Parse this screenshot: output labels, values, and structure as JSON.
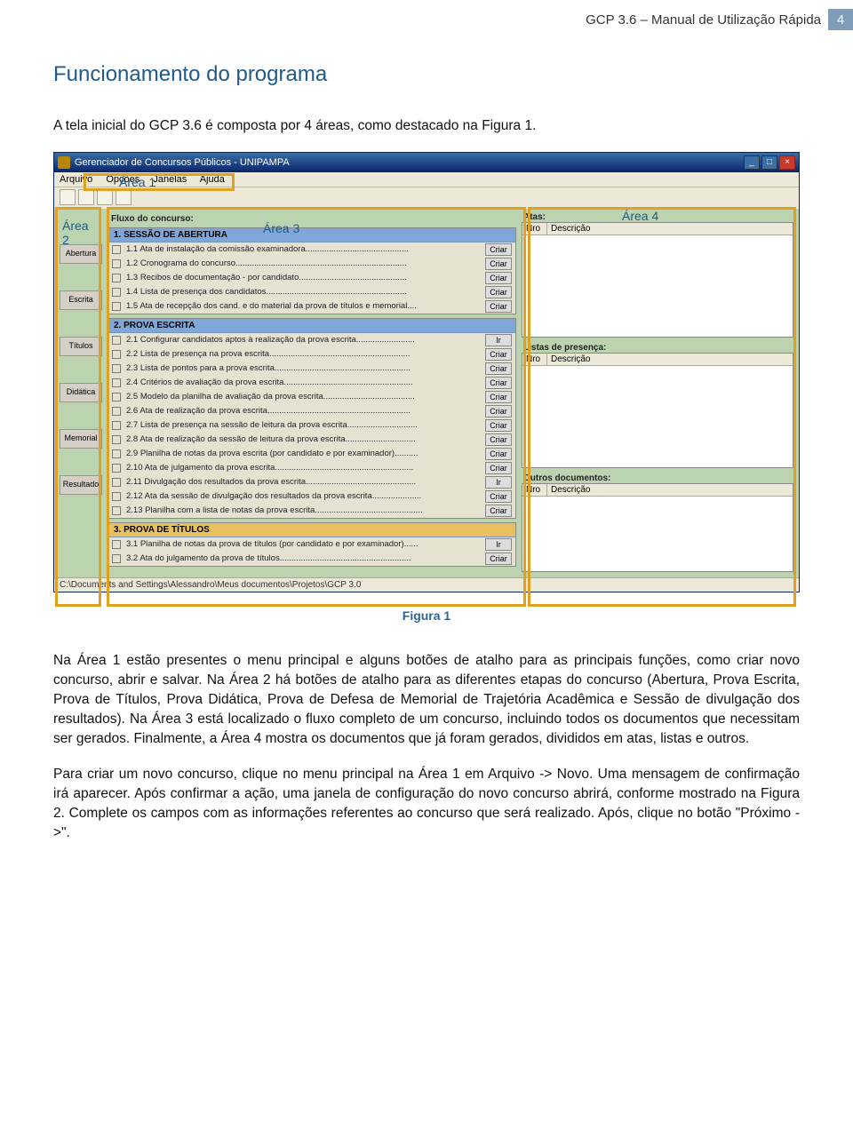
{
  "header": {
    "doc_title": "GCP 3.6 – Manual de Utilização Rápida",
    "page_num": "4"
  },
  "section": {
    "title": "Funcionamento do programa"
  },
  "intro": "A tela inicial do GCP 3.6 é composta por 4 áreas, como destacado na Figura 1.",
  "caption": "Figura 1",
  "window": {
    "title": "Gerenciador de Concursos Públicos - UNIPAMPA",
    "menu": {
      "arquivo": "Arquivo",
      "opcoes": "Opções",
      "janelas": "Janelas",
      "ajuda": "Ajuda"
    },
    "fluxo_label": "Fluxo do concurso:",
    "tabs": {
      "abertura": "Abertura",
      "escrita": "Escrita",
      "titulos": "Títulos",
      "didatica": "Didática",
      "memorial": "Memorial",
      "resultado": "Resultado"
    },
    "sect1": {
      "header": "1.  SESSÃO DE ABERTURA",
      "rows": [
        {
          "t": "1.1 Ata de instalação da comissão examinadora............................................",
          "b": "Criar"
        },
        {
          "t": "1.2 Cronograma do concurso.........................................................................",
          "b": "Criar"
        },
        {
          "t": "1.3 Recibos de documentação - por candidato..............................................",
          "b": "Criar"
        },
        {
          "t": "1.4 Lista de presença dos candidatos............................................................",
          "b": "Criar"
        },
        {
          "t": "1.5 Ata de recepção dos cand. e do material da prova de títulos e memorial....",
          "b": "Criar"
        }
      ]
    },
    "sect2": {
      "header": "2.  PROVA ESCRITA",
      "rows": [
        {
          "t": "2.1 Configurar candidatos aptos à realização da prova escrita.........................",
          "b": "Ir"
        },
        {
          "t": "2.2 Lista de presença na prova escrita............................................................",
          "b": "Criar"
        },
        {
          "t": "2.3 Lista de pontos para a prova escrita..........................................................",
          "b": "Criar"
        },
        {
          "t": "2.4 Critérios de avaliação da prova escrita.......................................................",
          "b": "Criar"
        },
        {
          "t": "2.5 Modelo da planilha de avaliação da prova escrita.......................................",
          "b": "Criar"
        },
        {
          "t": "2.6 Ata de realização da prova escrita.............................................................",
          "b": "Criar"
        },
        {
          "t": "2.7 Lista de presença na sessão de leitura da prova escrita..............................",
          "b": "Criar"
        },
        {
          "t": "2.8 Ata de realização da sessão de leitura da prova escrita..............................",
          "b": "Criar"
        },
        {
          "t": "2.9 Planilha de notas da prova escrita (por candidato e por examinador)..........",
          "b": "Criar"
        },
        {
          "t": "2.10 Ata de julgamento da prova escrita...........................................................",
          "b": "Criar"
        },
        {
          "t": "2.11 Divulgação dos resultados da prova escrita...............................................",
          "b": "Ir"
        },
        {
          "t": "2.12 Ata da sessão de divulgação dos resultados da prova escrita.....................",
          "b": "Criar"
        },
        {
          "t": "2.13 Planilha com a lista de notas da prova escrita..............................................",
          "b": "Criar"
        }
      ]
    },
    "sect3": {
      "header": "3.  PROVA DE TÍTULOS",
      "rows": [
        {
          "t": "3.1 Planilha de notas da prova de títulos (por candidato e por examinador)......",
          "b": "Ir"
        },
        {
          "t": "3.2 Ata do julgamento da prova de títulos........................................................",
          "b": "Criar"
        }
      ]
    },
    "right": {
      "atas_label": "Atas:",
      "listas_label": "Listas de presença:",
      "outros_label": "Outros documentos:",
      "col_nro": "Nro",
      "col_desc": "Descrição"
    },
    "status": "C:\\Documents and Settings\\Alessandro\\Meus documentos\\Projetos\\GCP 3.0"
  },
  "annotations": {
    "a1": "Área 1",
    "a2": "Área\n2",
    "a3": "Área 3",
    "a4": "Área 4"
  },
  "para1": "Na Área 1 estão presentes o menu principal e alguns botões de atalho para as principais funções, como criar novo concurso, abrir e salvar. Na Área 2 há botões de atalho para as diferentes etapas do concurso (Abertura, Prova Escrita, Prova de Títulos, Prova Didática, Prova de Defesa de Memorial de Trajetória Acadêmica e Sessão de divulgação dos resultados). Na Área 3 está localizado o fluxo completo de um concurso, incluindo todos os documentos que necessitam ser gerados. Finalmente, a Área 4 mostra os documentos que já foram gerados, divididos em atas, listas e outros.",
  "para2": "Para criar um novo concurso, clique no menu principal na Área 1 em Arquivo -> Novo. Uma mensagem de confirmação irá aparecer. Após confirmar a ação, uma janela de configuração do novo concurso abrirá, conforme mostrado na Figura 2. Complete os campos com as informações referentes ao concurso que será realizado. Após, clique no botão \"Próximo ->\"."
}
